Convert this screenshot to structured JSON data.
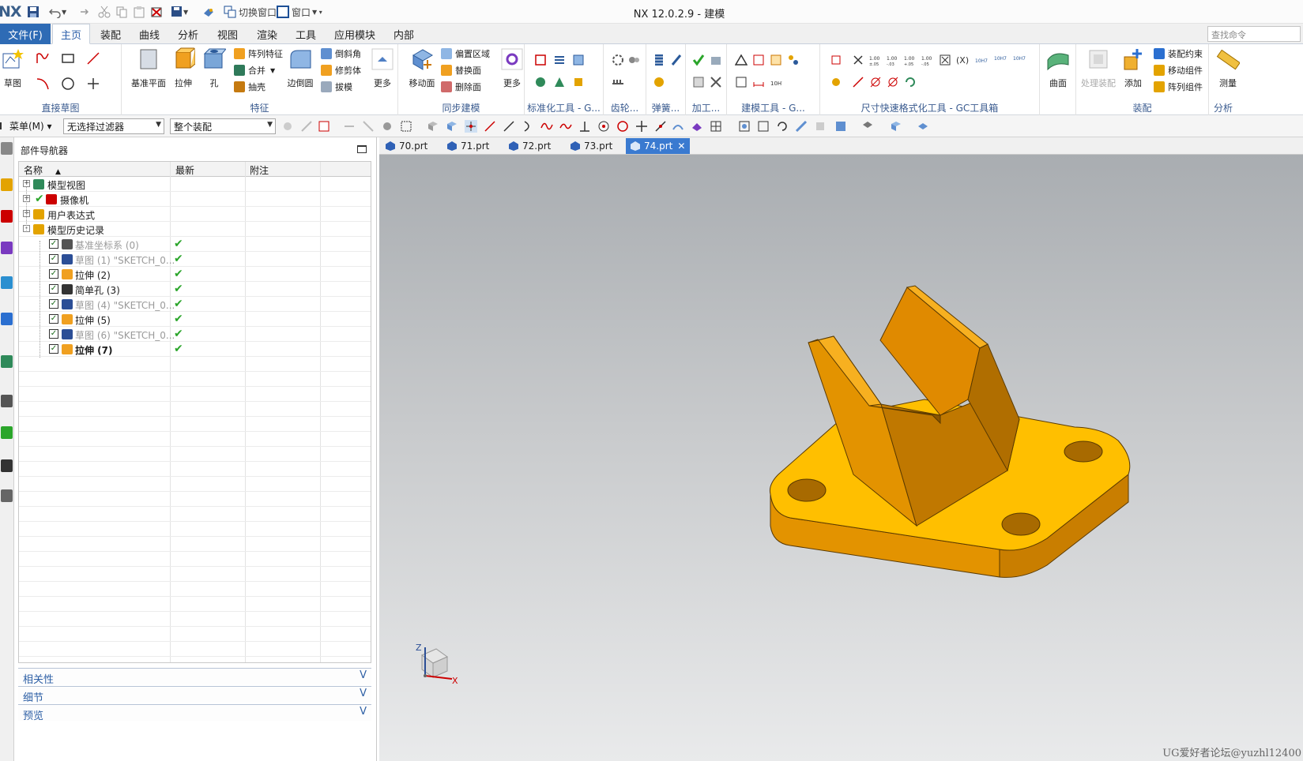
{
  "titlebar": {
    "logo": "NX",
    "title": "NX 12.0.2.9 - 建模",
    "switch_window": "切换窗口",
    "window_menu": "窗口"
  },
  "menubar": {
    "file": "文件(F)",
    "tabs": [
      "主页",
      "装配",
      "曲线",
      "分析",
      "视图",
      "渲染",
      "工具",
      "应用模块",
      "内部"
    ],
    "active_tab": "主页",
    "command_search_placeholder": "查找命令"
  },
  "ribbon": {
    "groups": {
      "direct_sketch": "直接草图",
      "feature": "特征",
      "sync_modeling": "同步建模",
      "std_tools": "标准化工具 - G...",
      "gear": "齿轮...",
      "spring": "弹簧...",
      "machining": "加工...",
      "modeling_tools": "建模工具 - G...",
      "dim_tools": "尺寸快速格式化工具 - GC工具箱",
      "assembly": "装配",
      "analysis": "分析"
    },
    "buttons": {
      "sketch": "草图",
      "datum_plane": "基准平面",
      "extrude": "拉伸",
      "hole": "孔",
      "pattern_feature": "阵列特征",
      "unite": "合并",
      "shell": "抽壳",
      "edge_blend": "边倒圆",
      "chamfer": "倒斜角",
      "trim_body": "修剪体",
      "draft": "拔模",
      "more": "更多",
      "move_face": "移动面",
      "offset_region": "偏置区域",
      "replace_face": "替换面",
      "delete_face": "删除面",
      "more2": "更多",
      "surface": "曲面",
      "process_assembly": "处理装配",
      "add": "添加",
      "assembly_constraints": "装配约束",
      "move_component": "移动组件",
      "pattern_component": "阵列组件",
      "measure": "测量"
    }
  },
  "selection_bar": {
    "menu": "菜单(M)",
    "filter": "无选择过滤器",
    "scope": "整个装配"
  },
  "navigator": {
    "title": "部件导航器",
    "columns": [
      "名称",
      "最新",
      "附注"
    ],
    "top_nodes": [
      {
        "label": "模型视图"
      },
      {
        "label": "摄像机"
      },
      {
        "label": "用户表达式"
      },
      {
        "label": "模型历史记录"
      }
    ],
    "history": [
      {
        "label": "基准坐标系 (0)",
        "dim": true,
        "bold": false
      },
      {
        "label": "草图 (1) \"SKETCH_0...",
        "dim": true,
        "bold": false
      },
      {
        "label": "拉伸 (2)",
        "dim": false,
        "bold": false
      },
      {
        "label": "简单孔 (3)",
        "dim": false,
        "bold": false
      },
      {
        "label": "草图 (4) \"SKETCH_0...",
        "dim": true,
        "bold": false
      },
      {
        "label": "拉伸 (5)",
        "dim": false,
        "bold": false
      },
      {
        "label": "草图 (6) \"SKETCH_0...",
        "dim": true,
        "bold": false
      },
      {
        "label": "拉伸 (7)",
        "dim": false,
        "bold": true
      }
    ],
    "panels": [
      "相关性",
      "细节",
      "预览"
    ]
  },
  "graphics": {
    "file_tabs": [
      "70.prt",
      "71.prt",
      "72.prt",
      "73.prt",
      "74.prt"
    ],
    "active_file": "74.prt",
    "axis_z": "Z",
    "axis_x": "X",
    "watermark": "UG爱好者论坛@yuzhl12400"
  },
  "colors": {
    "accent": "#2e6bb5",
    "part_top": "#ffbf00",
    "part_side": "#e08e00",
    "check_green": "#2aa52a"
  }
}
